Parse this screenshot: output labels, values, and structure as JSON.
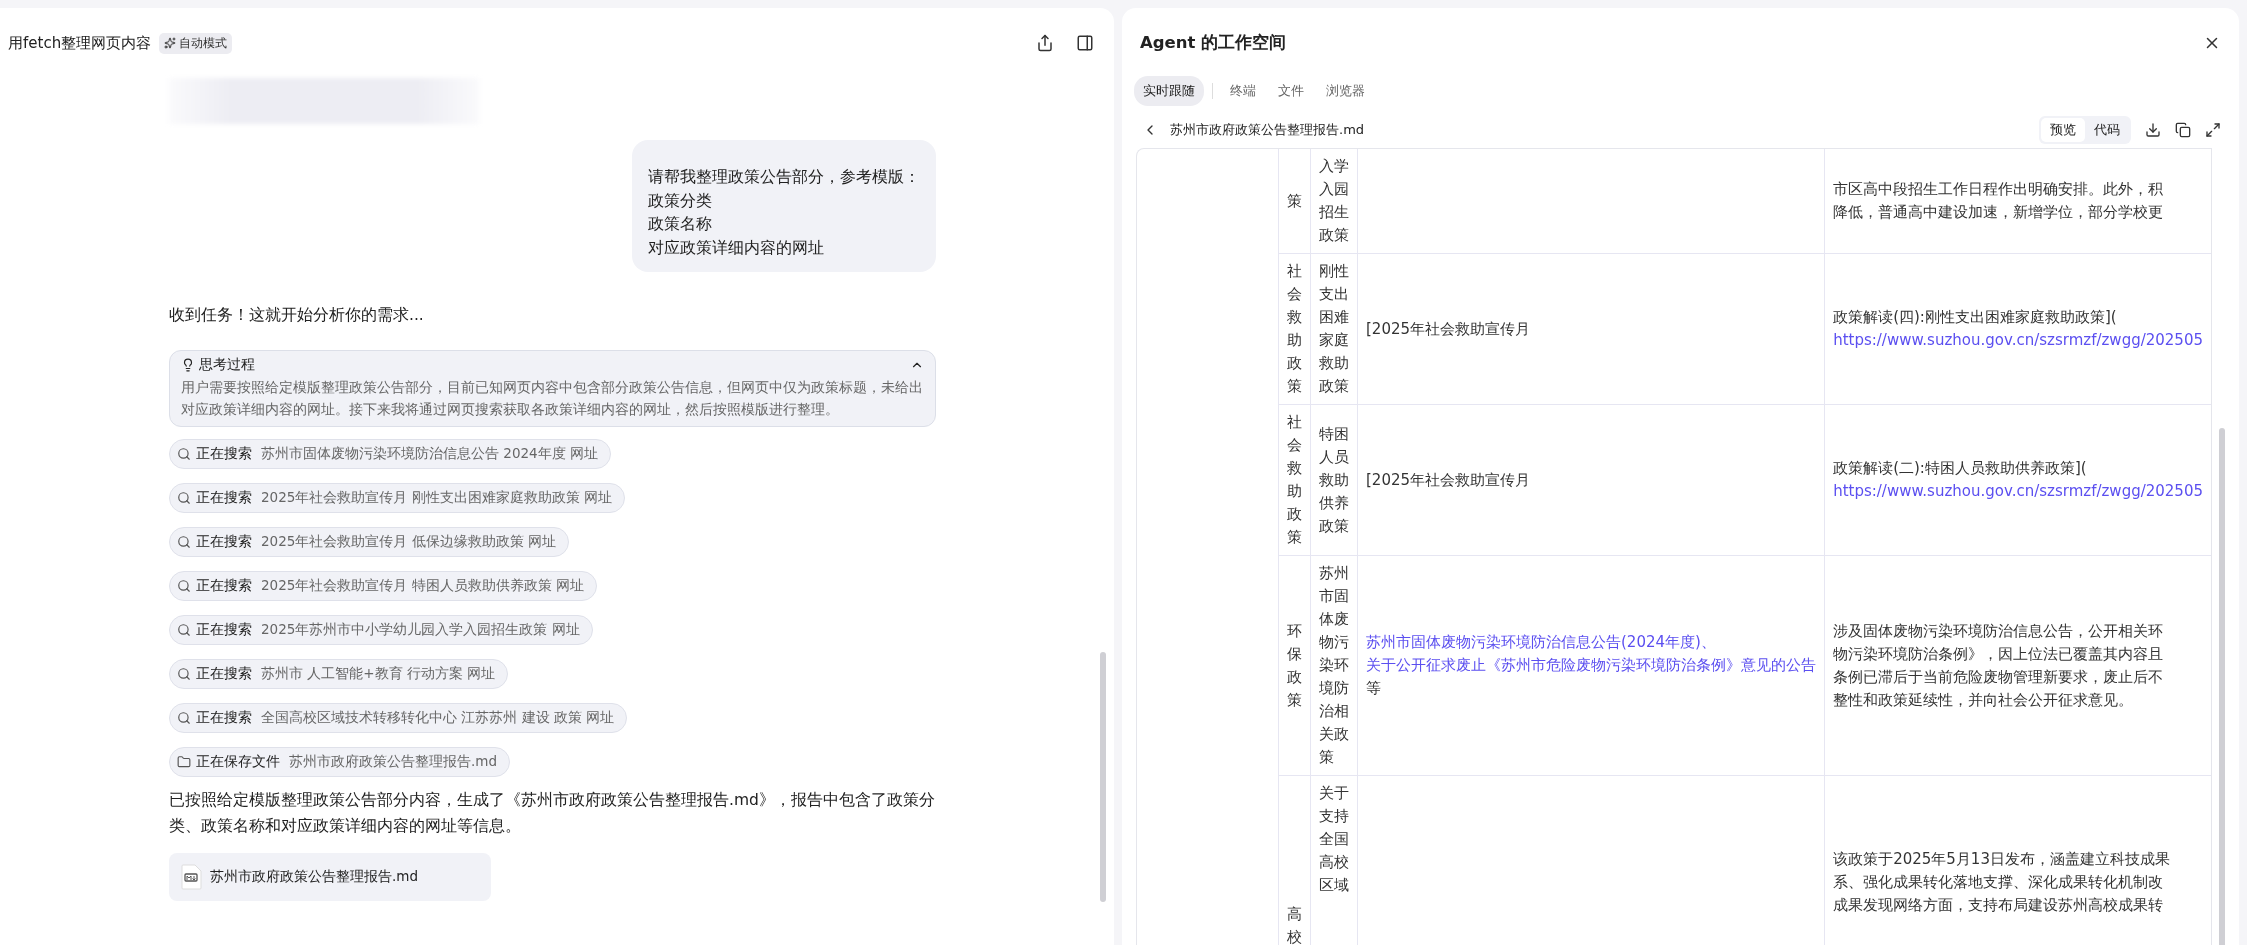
{
  "chat": {
    "title": "用fetch整理网页内容",
    "mode_badge": "自动模式",
    "user_message": [
      "请帮我整理政策公告部分，参考模版：",
      "政策分类",
      "政策名称",
      "对应政策详细内容的网址"
    ],
    "reply_intro": "收到任务！这就开始分析你的需求...",
    "thinking": {
      "title": "思考过程",
      "expanded": true,
      "text": "用户需要按照给定模版整理政策公告部分，目前已知网页内容中包含部分政策公告信息，但网页中仅为政策标题，未给出对应政策详细内容的网址。接下来我将通过网页搜索获取各政策详细内容的网址，然后按照模版进行整理。"
    },
    "steps": [
      {
        "kind": "search",
        "action": "正在搜索",
        "detail": "苏州市固体废物污染环境防治信息公告 2024年度 网址"
      },
      {
        "kind": "search",
        "action": "正在搜索",
        "detail": "2025年社会救助宣传月 刚性支出困难家庭救助政策 网址"
      },
      {
        "kind": "search",
        "action": "正在搜索",
        "detail": "2025年社会救助宣传月 低保边缘救助政策 网址"
      },
      {
        "kind": "search",
        "action": "正在搜索",
        "detail": "2025年社会救助宣传月 特困人员救助供养政策 网址"
      },
      {
        "kind": "search",
        "action": "正在搜索",
        "detail": "2025年苏州市中小学幼儿园入学入园招生政策 网址"
      },
      {
        "kind": "search",
        "action": "正在搜索",
        "detail": "苏州市 人工智能+教育 行动方案 网址"
      },
      {
        "kind": "search",
        "action": "正在搜索",
        "detail": "全国高校区域技术转移转化中心 江苏苏州 建设 政策 网址"
      },
      {
        "kind": "save",
        "action": "正在保存文件",
        "detail": "苏州市政府政策公告整理报告.md"
      }
    ],
    "summary": "已按照给定模版整理政策公告部分内容，生成了《苏州市政府政策公告整理报告.md》，报告中包含了政策分类、政策名称和对应政策详细内容的网址等信息。",
    "attachment": {
      "name": "苏州市政府政策公告整理报告.md"
    }
  },
  "workspace": {
    "title": "Agent 的工作空间",
    "tabs": [
      {
        "label": "实时跟随",
        "selected": true
      },
      {
        "label": "终端",
        "selected": false
      },
      {
        "label": "文件",
        "selected": false
      },
      {
        "label": "浏览器",
        "selected": false
      }
    ],
    "file_name": "苏州市政府政策公告整理报告.md",
    "view_modes": [
      {
        "label": "预览",
        "selected": true
      },
      {
        "label": "代码",
        "selected": false
      }
    ],
    "table": {
      "rows": [
        {
          "category": "策",
          "name": "入学入园招生政策",
          "title": [],
          "summary": [
            {
              "kind": "plain",
              "text": "市区高中段招生工作日程作出明确安排。此外，积"
            },
            {
              "kind": "plain",
              "text": "降低，普通高中建设加速，新增学位，部分学校更"
            }
          ]
        },
        {
          "category": "社会救助政策",
          "name": "刚性支出困难家庭救助政策",
          "title": [
            {
              "kind": "plain",
              "text": "[2025年社会救助宣传月"
            }
          ],
          "summary": [
            {
              "kind": "plain",
              "text": "政策解读(四):刚性支出困难家庭救助政策]("
            },
            {
              "kind": "link",
              "text": "https://www.suzhou.gov.cn/szsrmzf/zwgg/202505"
            }
          ]
        },
        {
          "category": "社会救助政策",
          "name": "特困人员救助供养政策",
          "title": [
            {
              "kind": "plain",
              "text": "[2025年社会救助宣传月"
            }
          ],
          "summary": [
            {
              "kind": "plain",
              "text": "政策解读(二):特困人员救助供养政策]("
            },
            {
              "kind": "link",
              "text": "https://www.suzhou.gov.cn/szsrmzf/zwgg/202505"
            }
          ]
        },
        {
          "category": "环保政策",
          "name": "苏州市固体废物污染环境防治相关政策",
          "title": [
            {
              "kind": "link",
              "text": "苏州市固体废物污染环境防治信息公告(2024年度)、"
            },
            {
              "kind": "link",
              "text": "关于公开征求废止《苏州市危险废物污染环境防治条例》意见的公告"
            },
            {
              "kind": "plain",
              "text": "等"
            }
          ],
          "summary": [
            {
              "kind": "plain",
              "text": "涉及固体废物污染环境防治信息公告，公开相关环"
            },
            {
              "kind": "plain",
              "text": "物污染环境防治条例》，因上位法已覆盖其内容且"
            },
            {
              "kind": "plain",
              "text": "条例已滞后于当前危险废物管理新要求，废止后不"
            },
            {
              "kind": "plain",
              "text": "整性和政策延续性，并向社会公开征求意见。"
            }
          ]
        },
        {
          "category": "高校",
          "name": "关于支持全国高校区域",
          "title": [],
          "summary": [
            {
              "kind": "plain",
              "text": "该政策于2025年5月13日发布，涵盖建立科技成果"
            },
            {
              "kind": "plain",
              "text": "系、强化成果转化落地支撑、深化成果转化机制改"
            },
            {
              "kind": "plain",
              "text": "成果发现网络方面，支持布局建设苏州高校成果转"
            }
          ]
        }
      ]
    }
  }
}
